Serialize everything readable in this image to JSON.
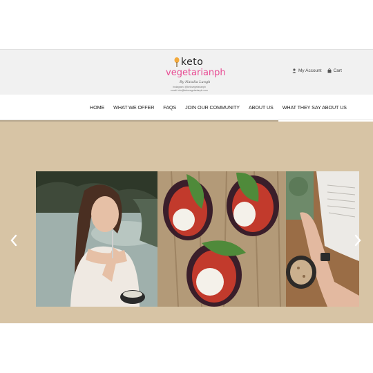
{
  "header": {
    "logo": {
      "word1": "keto",
      "word2": "vegetarianph",
      "byline": "By Natalia Lungh",
      "subline1": "Instagram: @ketovegetarianph",
      "subline2": "email: info@ketovegetarianph.com"
    },
    "account": {
      "my_account_label": "My Account",
      "cart_label": "Cart"
    }
  },
  "nav": {
    "items": [
      {
        "label": "HOME"
      },
      {
        "label": "WHAT WE OFFER"
      },
      {
        "label": "FAQS"
      },
      {
        "label": "JOIN OUR COMMUNITY"
      },
      {
        "label": "ABOUT US"
      },
      {
        "label": "WHAT THEY SAY ABOUT US"
      }
    ]
  },
  "hero": {
    "background_color": "#d7c4a5",
    "slides": [
      {
        "icon": "woman-eating-photo"
      },
      {
        "icon": "stuffed-eggplant-photo"
      },
      {
        "icon": "breakfast-bowl-reading-photo"
      }
    ],
    "prev_icon": "chevron-left-icon",
    "next_icon": "chevron-right-icon"
  },
  "colors": {
    "brand_pink": "#e84b93",
    "nav_accent": "#b7a78e"
  }
}
